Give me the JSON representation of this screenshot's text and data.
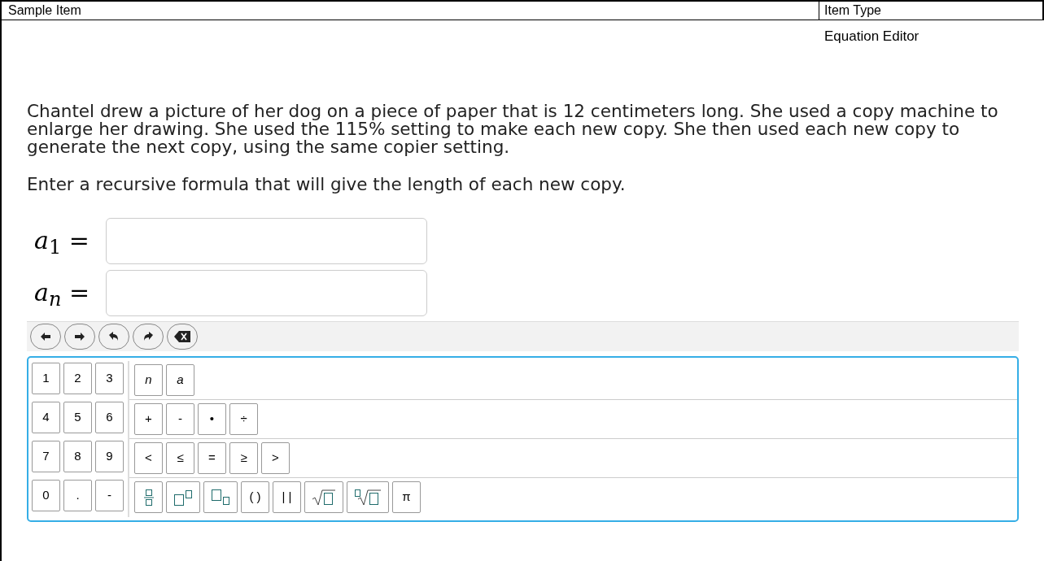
{
  "header": {
    "left": "Sample Item",
    "right": "Item Type"
  },
  "item_type": "Equation Editor",
  "stem": [
    "Chantel drew a picture of her dog on a piece of paper that is 12 centimeters long. She used a copy machine to enlarge her drawing. She used the 115% setting to make each new copy. She then used each new copy to generate the next copy, using the same copier setting.",
    "Enter a recursive formula that will give the length of each new copy."
  ],
  "answers": [
    {
      "variable": "a",
      "subscript": "1",
      "subscript_italic": false,
      "sign": "="
    },
    {
      "variable": "a",
      "subscript": "n",
      "subscript_italic": true,
      "sign": "="
    }
  ],
  "toolbar": [
    {
      "kind": "left"
    },
    {
      "kind": "right"
    },
    {
      "kind": "undo"
    },
    {
      "kind": "redo"
    },
    {
      "kind": "backspace"
    }
  ],
  "keypad": [
    {
      "digits": [
        "1",
        "2",
        "3"
      ],
      "keys": [
        {
          "kind": "text",
          "label": "n",
          "italic": true
        },
        {
          "kind": "text",
          "label": "a",
          "italic": true
        }
      ]
    },
    {
      "digits": [
        "4",
        "5",
        "6"
      ],
      "keys": [
        {
          "kind": "text",
          "label": "+",
          "italic": false
        },
        {
          "kind": "text",
          "label": "-",
          "italic": false
        },
        {
          "kind": "text",
          "label": "•",
          "italic": false
        },
        {
          "kind": "text",
          "label": "÷",
          "italic": false
        }
      ]
    },
    {
      "digits": [
        "7",
        "8",
        "9"
      ],
      "keys": [
        {
          "kind": "text",
          "label": "<",
          "italic": false
        },
        {
          "kind": "text",
          "label": "≤"
        },
        {
          "kind": "text",
          "label": "=",
          "italic": false
        },
        {
          "kind": "text",
          "label": "≥"
        },
        {
          "kind": "text",
          "label": ">",
          "italic": false
        }
      ]
    },
    {
      "digits": [
        "0",
        ".",
        "-"
      ],
      "keys": [
        {
          "kind": "fraction"
        },
        {
          "kind": "power"
        },
        {
          "kind": "subscript"
        },
        {
          "kind": "text",
          "label": "( )",
          "italic": false
        },
        {
          "kind": "text",
          "label": "| |",
          "italic": false
        },
        {
          "kind": "sqrt"
        },
        {
          "kind": "nthroot"
        },
        {
          "kind": "text",
          "label": "π",
          "italic": false
        }
      ]
    }
  ]
}
